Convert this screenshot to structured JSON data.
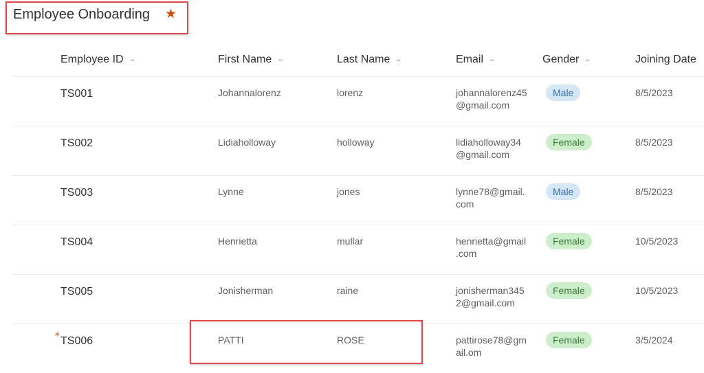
{
  "list": {
    "title": "Employee Onboarding",
    "favorite_icon": "star-icon",
    "accent_color": "#ca5010"
  },
  "columns": [
    {
      "label": "Employee ID",
      "sortable": true
    },
    {
      "label": "First Name",
      "sortable": true
    },
    {
      "label": "Last Name",
      "sortable": true
    },
    {
      "label": "Email",
      "sortable": true
    },
    {
      "label": "Gender",
      "sortable": true
    },
    {
      "label": "Joining Date",
      "sortable": false
    }
  ],
  "rows": [
    {
      "id": "TS001",
      "first": "Johannalorenz",
      "last": "lorenz",
      "email_1": "johannalorenz45",
      "email_2": "@gmail.com",
      "gender": "Male",
      "date": "8/5/2023",
      "is_new": false
    },
    {
      "id": "TS002",
      "first": "Lidiaholloway",
      "last": "holloway",
      "email_1": "lidiaholloway34",
      "email_2": "@gmail.com",
      "gender": "Female",
      "date": "8/5/2023",
      "is_new": false
    },
    {
      "id": "TS003",
      "first": "Lynne",
      "last": "jones",
      "email_1": "lynne78@gmail.",
      "email_2": "com",
      "gender": "Male",
      "date": "8/5/2023",
      "is_new": false
    },
    {
      "id": "TS004",
      "first": "Henrietta",
      "last": "mullar",
      "email_1": "henrietta@gmail",
      "email_2": ".com",
      "gender": "Female",
      "date": "10/5/2023",
      "is_new": false
    },
    {
      "id": "TS005",
      "first": "Jonisherman",
      "last": "raine",
      "email_1": "jonisherman345",
      "email_2": "2@gmail.com",
      "gender": "Female",
      "date": "10/5/2023",
      "is_new": false
    },
    {
      "id": "TS006",
      "first": "PATTI",
      "last": "ROSE",
      "email_1": "pattirose78@gm",
      "email_2": "ail.om",
      "gender": "Female",
      "date": "3/5/2024",
      "is_new": true
    }
  ],
  "gender_colors": {
    "Male": {
      "bg": "#d5e7f7",
      "fg": "#3a6ea5"
    },
    "Female": {
      "bg": "#cdeecb",
      "fg": "#3d7a3a"
    }
  },
  "annotation_color": "#e0484c"
}
